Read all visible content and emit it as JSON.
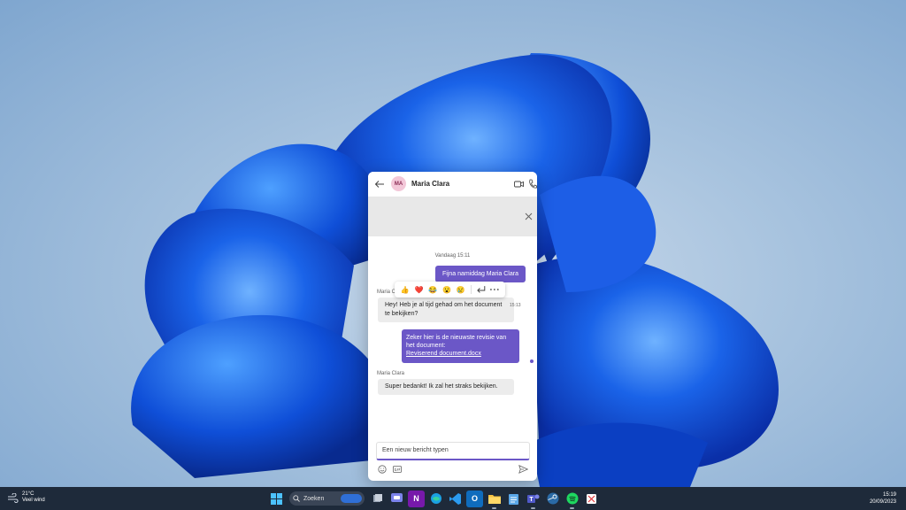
{
  "chat": {
    "contact_initials": "MA",
    "contact_name": "Maria Clara",
    "date_separator": "Vandaag 15:11",
    "outgoing_1": "Fijna namiddag Maria Clara",
    "incoming_sender": "Maria C",
    "incoming_1": "Hey! Heb je al tijd gehad om het document te bekijken?",
    "incoming_1_time": "15:13",
    "outgoing_2": "Zeker hier is de nieuwste revisie van het document:",
    "outgoing_2_link": "Reviserend document.docx",
    "incoming_2_sender": "Maria Clara",
    "incoming_2": "Super bedankt! Ik zal het straks bekijken.",
    "compose_placeholder": "Een nieuw bericht typen",
    "reactions": [
      "👍",
      "❤️",
      "😂",
      "😮",
      "😢"
    ],
    "accent_color": "#6b57c7"
  },
  "taskbar": {
    "weather_temp": "21°C",
    "weather_desc": "Veel wind",
    "search_label": "Zoeken",
    "time": "15:19",
    "date": "20/09/2023",
    "icons": [
      "windows-start",
      "file-explorer",
      "teams-chat",
      "onenote",
      "edge",
      "vscode",
      "outlook",
      "folder",
      "notepad",
      "teams",
      "steam",
      "spotify",
      "snipping-tool"
    ]
  }
}
